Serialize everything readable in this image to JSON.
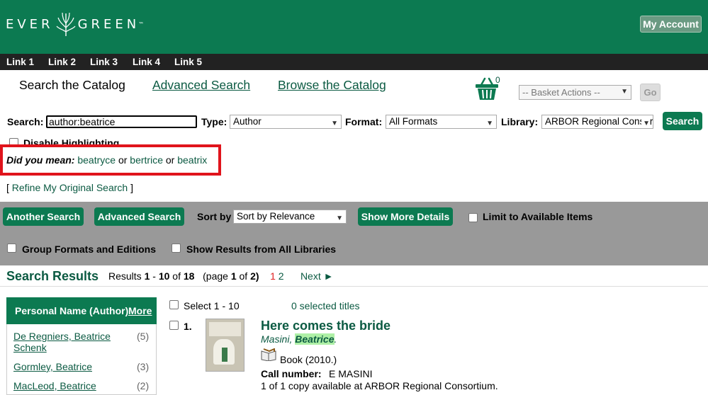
{
  "header": {
    "logo_text": "EVERGREEN",
    "logo_left": "EVER",
    "logo_right": "GREEN",
    "logo_tm": "™",
    "my_account": "My Account"
  },
  "linkbar": [
    "Link 1",
    "Link 2",
    "Link 3",
    "Link 4",
    "Link 5"
  ],
  "tabs": {
    "search_catalog": "Search the Catalog",
    "advanced_search": "Advanced Search",
    "browse_catalog": "Browse the Catalog"
  },
  "basket": {
    "count": "0",
    "actions_select": "-- Basket Actions --",
    "go": "Go"
  },
  "search": {
    "search_label": "Search:",
    "query": "author:beatrice",
    "type_label": "Type:",
    "type_value": "Author",
    "format_label": "Format:",
    "format_value": "All Formats",
    "library_label": "Library:",
    "library_value": "ARBOR Regional Consortium",
    "search_button": "Search",
    "disable_highlighting": "Disable Highlighting"
  },
  "did_you_mean": {
    "label": "Did you mean:",
    "sep": "or",
    "suggestions": [
      "beatryce",
      "bertrice",
      "beatrix"
    ]
  },
  "refine": {
    "open": "[",
    "link": "Refine My Original Search",
    "close": "]"
  },
  "toolbar": {
    "another_search": "Another Search",
    "advanced_search": "Advanced Search",
    "sort_label": "Sort by",
    "sort_value": "Sort by Relevance",
    "show_more_details": "Show More Details",
    "limit_available": "Limit to Available Items",
    "group_formats": "Group Formats and Editions",
    "show_all_libraries": "Show Results from All Libraries"
  },
  "results": {
    "title": "Search Results",
    "count_prefix": "Results",
    "start": "1",
    "dash": "-",
    "end": "10",
    "of": "of",
    "total": "18",
    "page_prefix": "(page",
    "page": "1",
    "page_of": "of",
    "pages": "2)",
    "page_current": "1",
    "page_two": "2",
    "next": "Next ►",
    "select_label": "Select 1 - 10",
    "selected_titles": "0 selected titles"
  },
  "facets": {
    "header": "Personal Name (Author)",
    "more": "More",
    "items": [
      {
        "name": "De Regniers, Beatrice",
        "name2": "Schenk",
        "count": "(5)"
      },
      {
        "name": "Gormley, Beatrice",
        "count": "(3)"
      },
      {
        "name": "MacLeod, Beatrice",
        "count": "(2)"
      }
    ]
  },
  "record": {
    "number": "1.",
    "title": "Here comes the bride",
    "author_last": "Masini,",
    "author_first": "Beatrice",
    "author_end": ".",
    "format": "Book (2010.)",
    "call_label": "Call number:",
    "call_value": "E MASINI",
    "availability": "1 of 1 copy available at ARBOR Regional Consortium."
  },
  "colors": {
    "brand_green": "#0c7a51",
    "link_green": "#0b5a42",
    "highlight_red": "#e0141c",
    "toolbar_gray": "#999999",
    "page_red": "#e02020"
  }
}
